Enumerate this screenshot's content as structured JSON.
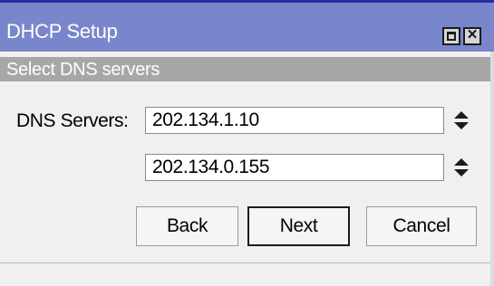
{
  "window": {
    "title": "DHCP Setup",
    "maximize_icon": "maximize-icon",
    "close_icon": "close-icon",
    "title_color": "#7a86cc"
  },
  "section": {
    "heading": "Select DNS servers",
    "color": "#a7a7a7"
  },
  "form": {
    "dns_label": "DNS Servers:",
    "dns_server_1": "202.134.1.10",
    "dns_server_2": "202.134.0.155",
    "spinner_icon": "up-down-arrows-icon"
  },
  "buttons": {
    "back": "Back",
    "next": "Next",
    "cancel": "Cancel"
  }
}
